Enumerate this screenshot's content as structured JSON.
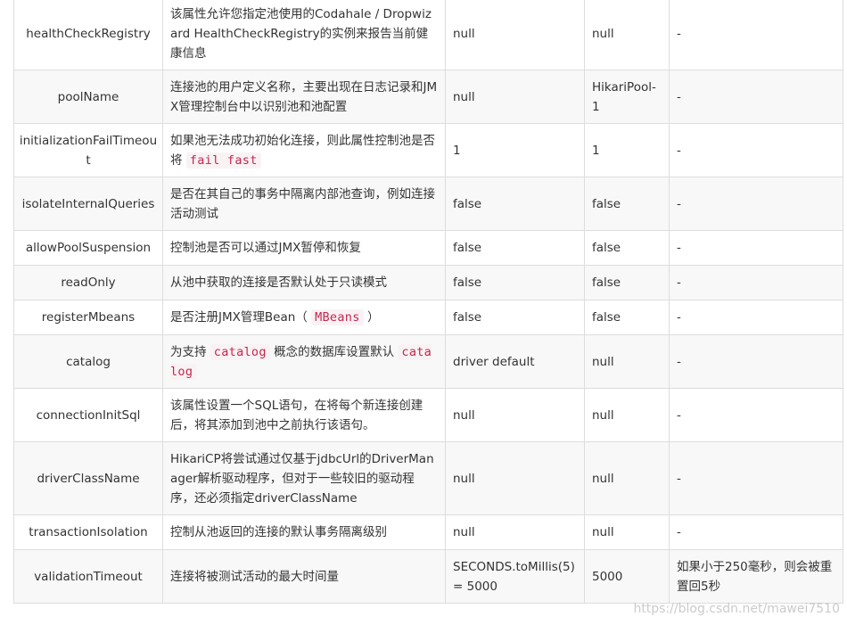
{
  "rows": [
    {
      "name": "healthCheckRegistry",
      "desc": [
        "该属性允许您指定池使用的Codahale / Dropwizard HealthCheckRegistry的实例来报告当前健康信息"
      ],
      "default": "null",
      "value": "null",
      "note": "-"
    },
    {
      "name": "poolName",
      "desc": [
        "连接池的用户定义名称，主要出现在日志记录和JMX管理控制台中以识别池和池配置"
      ],
      "default": "null",
      "value": "HikariPool-1",
      "note": "-"
    },
    {
      "name": "initializationFailTimeout",
      "desc": [
        "如果池无法成功初始化连接，则此属性控制池是否将 ",
        {
          "code": "fail fast"
        }
      ],
      "default": "1",
      "value": "1",
      "note": "-"
    },
    {
      "name": "isolateInternalQueries",
      "desc": [
        "是否在其自己的事务中隔离内部池查询，例如连接活动测试"
      ],
      "default": "false",
      "value": "false",
      "note": "-"
    },
    {
      "name": "allowPoolSuspension",
      "desc": [
        "控制池是否可以通过JMX暂停和恢复"
      ],
      "default": "false",
      "value": "false",
      "note": "-"
    },
    {
      "name": "readOnly",
      "desc": [
        "从池中获取的连接是否默认处于只读模式"
      ],
      "default": "false",
      "value": "false",
      "note": "-"
    },
    {
      "name": "registerMbeans",
      "desc": [
        "是否注册JMX管理Bean（ ",
        {
          "code": "MBeans"
        },
        " ）"
      ],
      "default": "false",
      "value": "false",
      "note": "-"
    },
    {
      "name": "catalog",
      "desc": [
        "为支持 ",
        {
          "code": "catalog"
        },
        " 概念的数据库设置默认 ",
        {
          "code": "catalog"
        }
      ],
      "default": "driver default",
      "value": "null",
      "note": "-"
    },
    {
      "name": "connectionInitSql",
      "desc": [
        "该属性设置一个SQL语句，在将每个新连接创建后，将其添加到池中之前执行该语句。"
      ],
      "default": "null",
      "value": "null",
      "note": "-"
    },
    {
      "name": "driverClassName",
      "desc": [
        "HikariCP将尝试通过仅基于jdbcUrl的DriverManager解析驱动程序，但对于一些较旧的驱动程序，还必须指定driverClassName"
      ],
      "default": "null",
      "value": "null",
      "note": "-"
    },
    {
      "name": "transactionIsolation",
      "desc": [
        "控制从池返回的连接的默认事务隔离级别"
      ],
      "default": "null",
      "value": "null",
      "note": "-"
    },
    {
      "name": "validationTimeout",
      "desc": [
        "连接将被测试活动的最大时间量"
      ],
      "default": "SECONDS.toMillis(5) = 5000",
      "value": "5000",
      "note": "如果小于250毫秒，则会被重置回5秒"
    }
  ],
  "watermark": "https://blog.csdn.net/mawei7510"
}
